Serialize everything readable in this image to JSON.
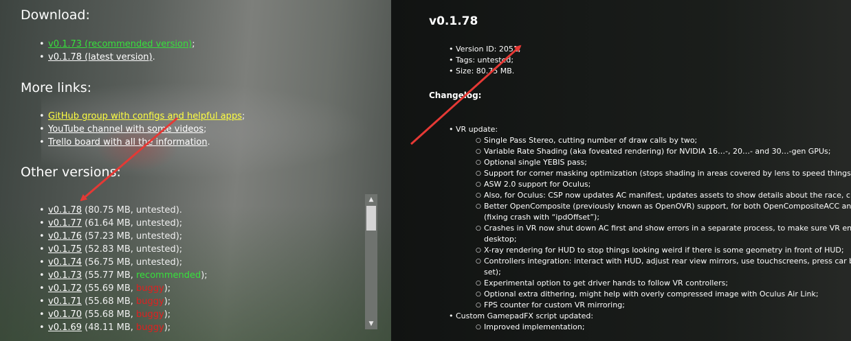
{
  "left": {
    "download_heading": "Download:",
    "download_items": [
      {
        "link": "v0.1.73 (recommended version)",
        "tail": ";"
      },
      {
        "link": "v0.1.78 (latest version)",
        "tail": "."
      }
    ],
    "more_links_heading": "More links:",
    "more_links": [
      {
        "link": "GitHub group with configs and helpful apps",
        "tail": ";"
      },
      {
        "link": "YouTube channel with some videos",
        "tail": ";"
      },
      {
        "link": "Trello board with all the information",
        "tail": "."
      }
    ],
    "other_versions_heading": "Other versions:",
    "versions": [
      {
        "link": "v0.1.78",
        "pre": " (80.75 MB, untested).",
        "tag": "",
        "post": ""
      },
      {
        "link": "v0.1.77",
        "pre": " (61.64 MB, untested);",
        "tag": "",
        "post": ""
      },
      {
        "link": "v0.1.76",
        "pre": " (57.23 MB, untested);",
        "tag": "",
        "post": ""
      },
      {
        "link": "v0.1.75",
        "pre": " (52.83 MB, untested);",
        "tag": "",
        "post": ""
      },
      {
        "link": "v0.1.74",
        "pre": " (56.75 MB, untested);",
        "tag": "",
        "post": ""
      },
      {
        "link": "v0.1.73",
        "pre": " (55.77 MB, ",
        "tag": "recommended",
        "post": ");"
      },
      {
        "link": "v0.1.72",
        "pre": " (55.69 MB, ",
        "tag": "buggy",
        "post": ");"
      },
      {
        "link": "v0.1.71",
        "pre": " (55.68 MB, ",
        "tag": "buggy",
        "post": ");"
      },
      {
        "link": "v0.1.70",
        "pre": " (55.68 MB, ",
        "tag": "buggy",
        "post": ");"
      },
      {
        "link": "v0.1.69",
        "pre": " (48.11 MB, ",
        "tag": "buggy",
        "post": ");"
      }
    ]
  },
  "right": {
    "title": "v0.1.78",
    "info": [
      "Version ID: 2051;",
      "Tags: untested;",
      "Size: 80.75 MB."
    ],
    "changelog_heading": "Changelog:",
    "vr_update": "VR update:",
    "vr_items": [
      "Single Pass Stereo, cutting number of draw calls by two;",
      "Variable Rate Shading (aka foveated rendering) for NVIDIA 16…-, 20…- and 30…-gen GPUs;",
      "Optional single YEBIS pass;",
      "Support for corner masking optimization (stops shading in areas covered by lens to speed things up);",
      "ASW 2.0 support for Oculus;",
      "Also, for Oculus: CSP now updates AC manifest, updates assets to show details about the race, closes",
      "Better OpenComposite (previously known as OpenOVR) support, for both OpenCompositeACC and re",
      "(fixing crash with “ipdOffset”);",
      "Crashes in VR now shut down AC first and show errors in a separate process, to make sure VR environ",
      "desktop;",
      "X-ray rendering for HUD to stop things looking weird if there is some geometry in front of HUD;",
      "Controllers integration: interact with HUD, adjust rear view mirrors, use touchscreens, press car button",
      "set);",
      "Experimental option to get driver hands to follow VR controllers;",
      "Optional extra dithering, might help with overly compressed image with Oculus Air Link;",
      "FPS counter for custom VR mirroring;"
    ],
    "gamepad_update": "Custom GamepadFX script updated:",
    "gamepad_items": [
      "Improved implementation;"
    ]
  },
  "colors": {
    "recommended": "#37e13c",
    "buggy": "#e21f1f",
    "highlight_link": "#ffff40",
    "arrow": "#e53935"
  },
  "icons": {
    "scroll_up": "scroll-up-arrow-icon",
    "scroll_down": "scroll-down-arrow-icon"
  }
}
